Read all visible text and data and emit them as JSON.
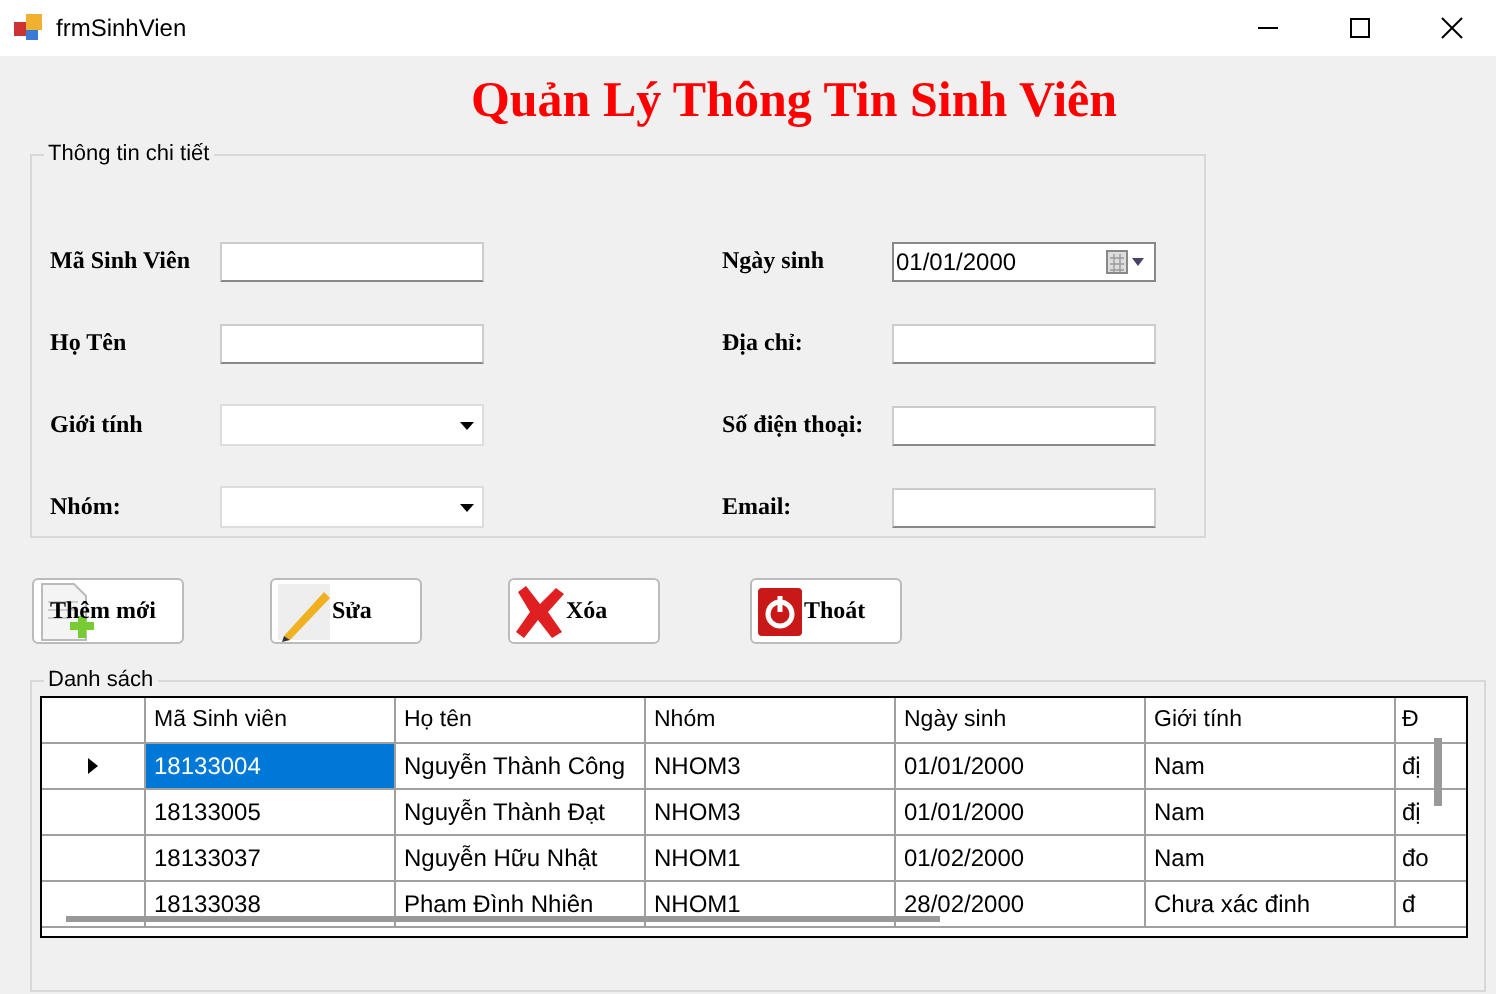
{
  "window": {
    "title": "frmSinhVien"
  },
  "heading": "Quản Lý Thông Tin Sinh Viên",
  "details": {
    "title": "Thông tin chi tiết",
    "left": [
      {
        "label": "Mã Sinh Viên",
        "kind": "text"
      },
      {
        "label": "Họ Tên",
        "kind": "text"
      },
      {
        "label": "Giới  tính",
        "kind": "combo"
      },
      {
        "label": "Nhóm:",
        "kind": "combo"
      }
    ],
    "right": [
      {
        "label": "Ngày sinh",
        "kind": "date",
        "value": "01/01/2000"
      },
      {
        "label": "Địa chỉ:",
        "kind": "text"
      },
      {
        "label": "Số điện thoại:",
        "kind": "text"
      },
      {
        "label": "Email:",
        "kind": "text"
      }
    ]
  },
  "buttons": [
    {
      "label": "Thêm mới",
      "kind": "add"
    },
    {
      "label": "Sửa",
      "kind": "edit"
    },
    {
      "label": "Xóa",
      "kind": "delete"
    },
    {
      "label": "Thoát",
      "kind": "exit"
    }
  ],
  "list": {
    "title": "Danh sách",
    "columns": [
      "Mã Sinh viên",
      "Họ tên",
      "Nhóm",
      "Ngày sinh",
      "Giới tính",
      "Đ"
    ],
    "rows": [
      {
        "selected": true,
        "cells": [
          "18133004",
          "Nguyễn Thành Công",
          "NHOM3",
          "01/01/2000",
          "Nam",
          "đị"
        ]
      },
      {
        "selected": false,
        "cells": [
          "18133005",
          "Nguyễn Thành Đạt",
          "NHOM3",
          "01/01/2000",
          "Nam",
          "đị"
        ]
      },
      {
        "selected": false,
        "cells": [
          "18133037",
          "Nguyễn Hữu Nhật",
          "NHOM1",
          "01/02/2000",
          "Nam",
          "đo"
        ]
      },
      {
        "selected": false,
        "cells": [
          "18133038",
          "Pham Đình Nhiên",
          "NHOM1",
          "28/02/2000",
          "Chưa xác đinh",
          "đ"
        ]
      }
    ]
  }
}
